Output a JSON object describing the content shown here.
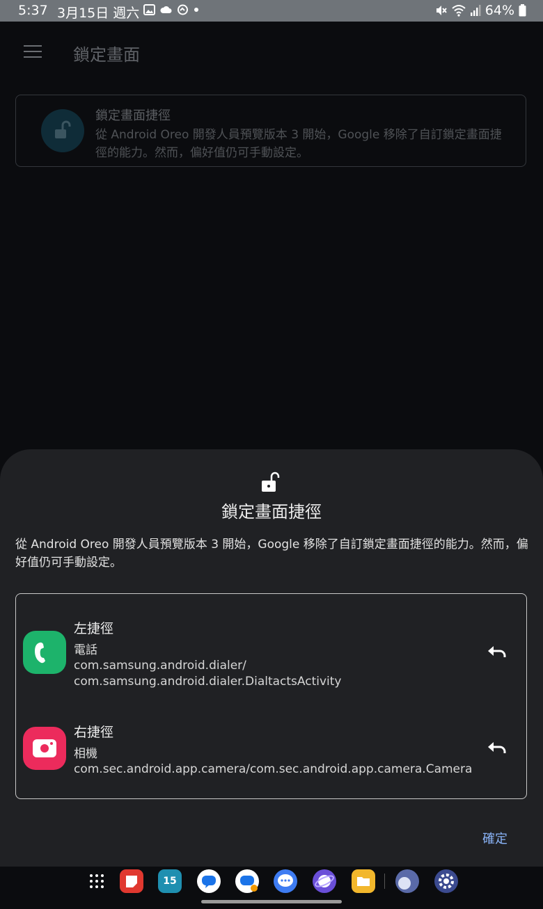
{
  "status_bar": {
    "time": "5:37",
    "date": "3月15日 週六",
    "battery": "64%",
    "icons": [
      "image-icon",
      "cloud-icon",
      "sync-icon",
      "dot-icon",
      "mute-icon",
      "wifi-icon",
      "signal-icon",
      "battery-icon"
    ]
  },
  "app_bar": {
    "title": "鎖定畫面",
    "menu_icon": "hamburger-menu-icon"
  },
  "background_card": {
    "title": "鎖定畫面捷徑",
    "description": "從 Android Oreo 開發人員預覽版本 3 開始，Google 移除了自訂鎖定畫面捷徑的能力。然而，偏好值仍可手動設定。",
    "icon": "lock-open-icon"
  },
  "sheet": {
    "icon": "lock-open-icon",
    "title": "鎖定畫面捷徑",
    "description": "從 Android Oreo 開發人員預覽版本 3 開始，Google 移除了自訂鎖定畫面捷徑的能力。然而，偏好值仍可手動設定。",
    "items": [
      {
        "title": "左捷徑",
        "app_name": "電話",
        "package_line1": "com.samsung.android.dialer/",
        "package_line2": "com.samsung.android.dialer.DialtactsActivity",
        "icon": "phone-app-icon",
        "icon_color": "#1db36b",
        "action_icon": "undo-icon"
      },
      {
        "title": "右捷徑",
        "app_name": "相機",
        "package_line1": "com.sec.android.app.camera/com.sec.android.app.camera.Camera",
        "package_line2": "",
        "icon": "camera-app-icon",
        "icon_color": "#ec2b5c",
        "action_icon": "undo-icon"
      }
    ],
    "confirm_label": "確定"
  },
  "dock": {
    "apps": [
      {
        "name": "app-drawer-icon",
        "label": ""
      },
      {
        "name": "notes-app-icon",
        "label": ""
      },
      {
        "name": "calendar-app-icon",
        "label": "15"
      },
      {
        "name": "chat-app-icon",
        "label": ""
      },
      {
        "name": "messages-app-icon",
        "label": ""
      },
      {
        "name": "samsung-messages-app-icon",
        "label": ""
      },
      {
        "name": "internet-app-icon",
        "label": ""
      },
      {
        "name": "files-app-icon",
        "label": ""
      },
      {
        "name": "recent-app-icon",
        "label": ""
      },
      {
        "name": "settings-app-icon",
        "label": ""
      }
    ]
  }
}
